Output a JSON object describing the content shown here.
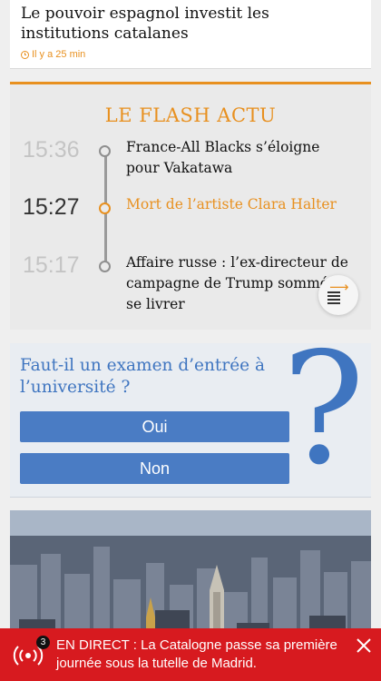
{
  "top_article": {
    "title": "Le pouvoir espagnol investit les institutions catalanes",
    "time_ago": "Il y a 25 min"
  },
  "flash": {
    "title": "LE FLASH ACTU",
    "items": [
      {
        "time": "15:36",
        "text": "France-All Blacks s’éloigne pour Vakatawa"
      },
      {
        "time": "15:27",
        "text": "Mort de l’artiste Clara Halter"
      },
      {
        "time": "15:17",
        "text": "Affaire russe : l’ex-directeur de campagne de Trump sommé de se livrer"
      }
    ]
  },
  "poll": {
    "question": "Faut-il un examen d’entrée à l’université ?",
    "options": [
      "Oui",
      "Non"
    ]
  },
  "live_banner": {
    "badge": "3",
    "label": "EN DIRECT :",
    "text": "La Catalogne passe sa première journée sous la tutelle de Madrid."
  },
  "colors": {
    "accent": "#e8901f",
    "poll_blue": "#3f75c0",
    "live_red": "#d71a1f"
  }
}
